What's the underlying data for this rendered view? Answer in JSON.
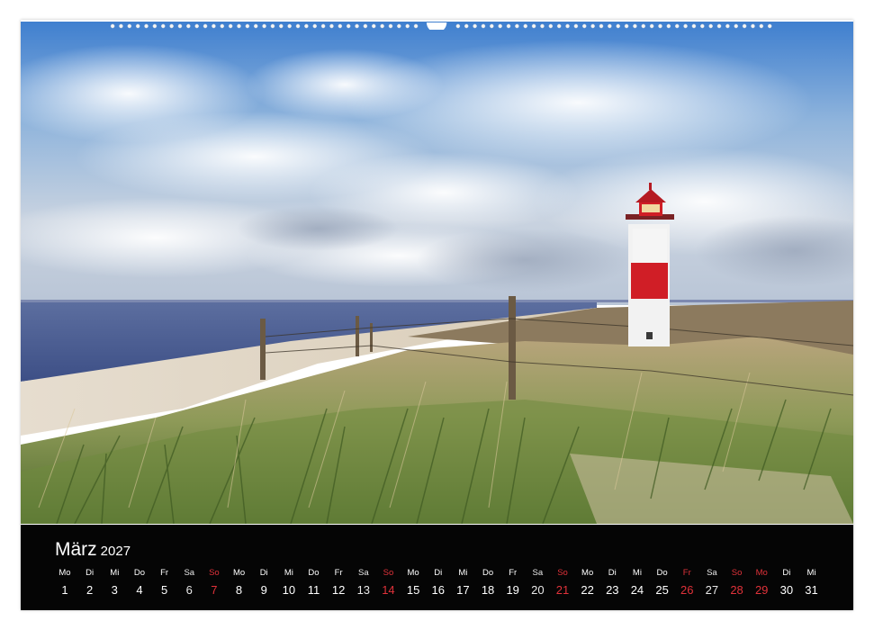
{
  "calendar": {
    "month": "März",
    "year": "2027",
    "days": [
      {
        "wd": "Mo",
        "d": "1",
        "type": "work"
      },
      {
        "wd": "Di",
        "d": "2",
        "type": "work"
      },
      {
        "wd": "Mi",
        "d": "3",
        "type": "work"
      },
      {
        "wd": "Do",
        "d": "4",
        "type": "work"
      },
      {
        "wd": "Fr",
        "d": "5",
        "type": "work"
      },
      {
        "wd": "Sa",
        "d": "6",
        "type": "sat"
      },
      {
        "wd": "So",
        "d": "7",
        "type": "sun"
      },
      {
        "wd": "Mo",
        "d": "8",
        "type": "work"
      },
      {
        "wd": "Di",
        "d": "9",
        "type": "work"
      },
      {
        "wd": "Mi",
        "d": "10",
        "type": "work"
      },
      {
        "wd": "Do",
        "d": "11",
        "type": "work"
      },
      {
        "wd": "Fr",
        "d": "12",
        "type": "work"
      },
      {
        "wd": "Sa",
        "d": "13",
        "type": "sat"
      },
      {
        "wd": "So",
        "d": "14",
        "type": "sun"
      },
      {
        "wd": "Mo",
        "d": "15",
        "type": "work"
      },
      {
        "wd": "Di",
        "d": "16",
        "type": "work"
      },
      {
        "wd": "Mi",
        "d": "17",
        "type": "work"
      },
      {
        "wd": "Do",
        "d": "18",
        "type": "work"
      },
      {
        "wd": "Fr",
        "d": "19",
        "type": "work"
      },
      {
        "wd": "Sa",
        "d": "20",
        "type": "sat"
      },
      {
        "wd": "So",
        "d": "21",
        "type": "sun"
      },
      {
        "wd": "Mo",
        "d": "22",
        "type": "work"
      },
      {
        "wd": "Di",
        "d": "23",
        "type": "work"
      },
      {
        "wd": "Mi",
        "d": "24",
        "type": "work"
      },
      {
        "wd": "Do",
        "d": "25",
        "type": "work"
      },
      {
        "wd": "Fr",
        "d": "26",
        "type": "sun"
      },
      {
        "wd": "Sa",
        "d": "27",
        "type": "sat"
      },
      {
        "wd": "So",
        "d": "28",
        "type": "sun"
      },
      {
        "wd": "Mo",
        "d": "29",
        "type": "sun"
      },
      {
        "wd": "Di",
        "d": "30",
        "type": "work"
      },
      {
        "wd": "Mi",
        "d": "31",
        "type": "work"
      }
    ]
  },
  "colors": {
    "calendar_bg": "#050505",
    "holiday_red": "#e0323a",
    "lighthouse_red": "#d01e26"
  }
}
